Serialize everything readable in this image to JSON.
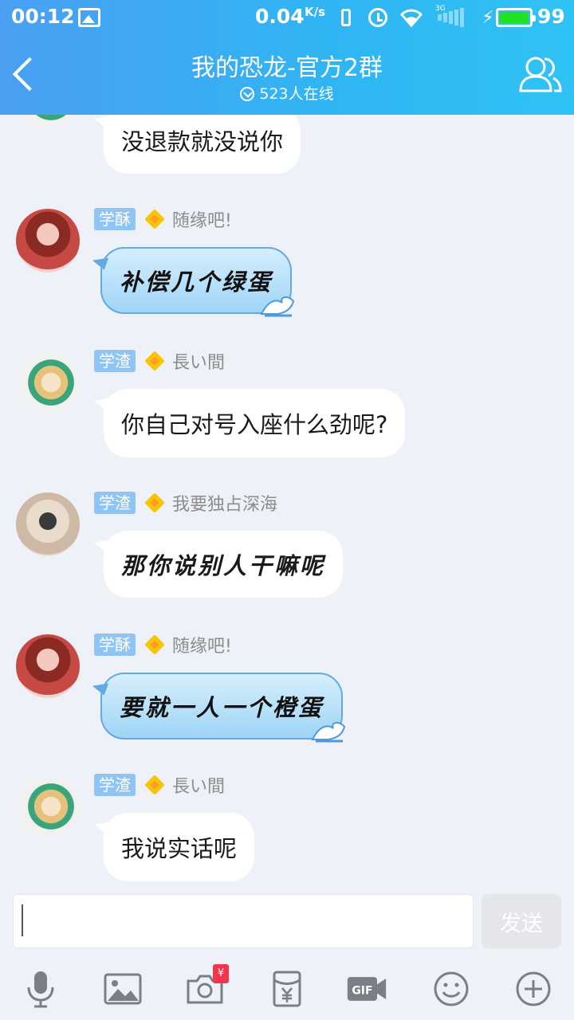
{
  "status_bar": {
    "time": "00:12",
    "speed": "0.04",
    "speed_unit": "K/s",
    "network_type": "3G",
    "battery": "99"
  },
  "header": {
    "back_icon": "chevron-left-icon",
    "title": "我的恐龙-官方2群",
    "online_text": "523人在线",
    "members_icon": "group-members-icon"
  },
  "messages": [
    {
      "text": "没退款就没说你",
      "style": "plain",
      "avatar": "avatar-xuezha-anime"
    },
    {
      "tag": "学酥",
      "nick": "随缘吧!",
      "text": "补偿几个绿蛋",
      "style": "themed",
      "avatar": "avatar-red-hair"
    },
    {
      "tag": "学渣",
      "nick": "長い間",
      "text": "你自己对号入座什么劲呢?",
      "style": "plain",
      "avatar": "avatar-xuezha-anime"
    },
    {
      "tag": "学渣",
      "nick": "我要独占深海",
      "text": "那你说别人干嘛呢",
      "style": "plain",
      "avatar": "avatar-person-photo"
    },
    {
      "tag": "学酥",
      "nick": "随缘吧!",
      "text": "要就一人一个橙蛋",
      "style": "themed",
      "avatar": "avatar-red-hair"
    },
    {
      "tag": "学渣",
      "nick": "長い間",
      "text": "我说实话呢",
      "style": "plain",
      "avatar": "avatar-xuezha-anime"
    }
  ],
  "input": {
    "value": "",
    "placeholder": "",
    "send_label": "发送"
  },
  "toolbar": {
    "items": [
      {
        "icon": "microphone-icon"
      },
      {
        "icon": "image-icon"
      },
      {
        "icon": "camera-icon",
        "badge": "¥"
      },
      {
        "icon": "red-packet-icon"
      },
      {
        "icon": "gif-icon"
      },
      {
        "icon": "emoji-icon"
      },
      {
        "icon": "plus-icon"
      }
    ]
  },
  "colors": {
    "header_gradient_start": "#4a9ff2",
    "header_gradient_end": "#2fc2f4",
    "chat_background": "#eef1f7",
    "tag_blue": "#8fc4f3",
    "battery_green": "#1ee31e",
    "toolbar_icon": "#7a7f87"
  }
}
